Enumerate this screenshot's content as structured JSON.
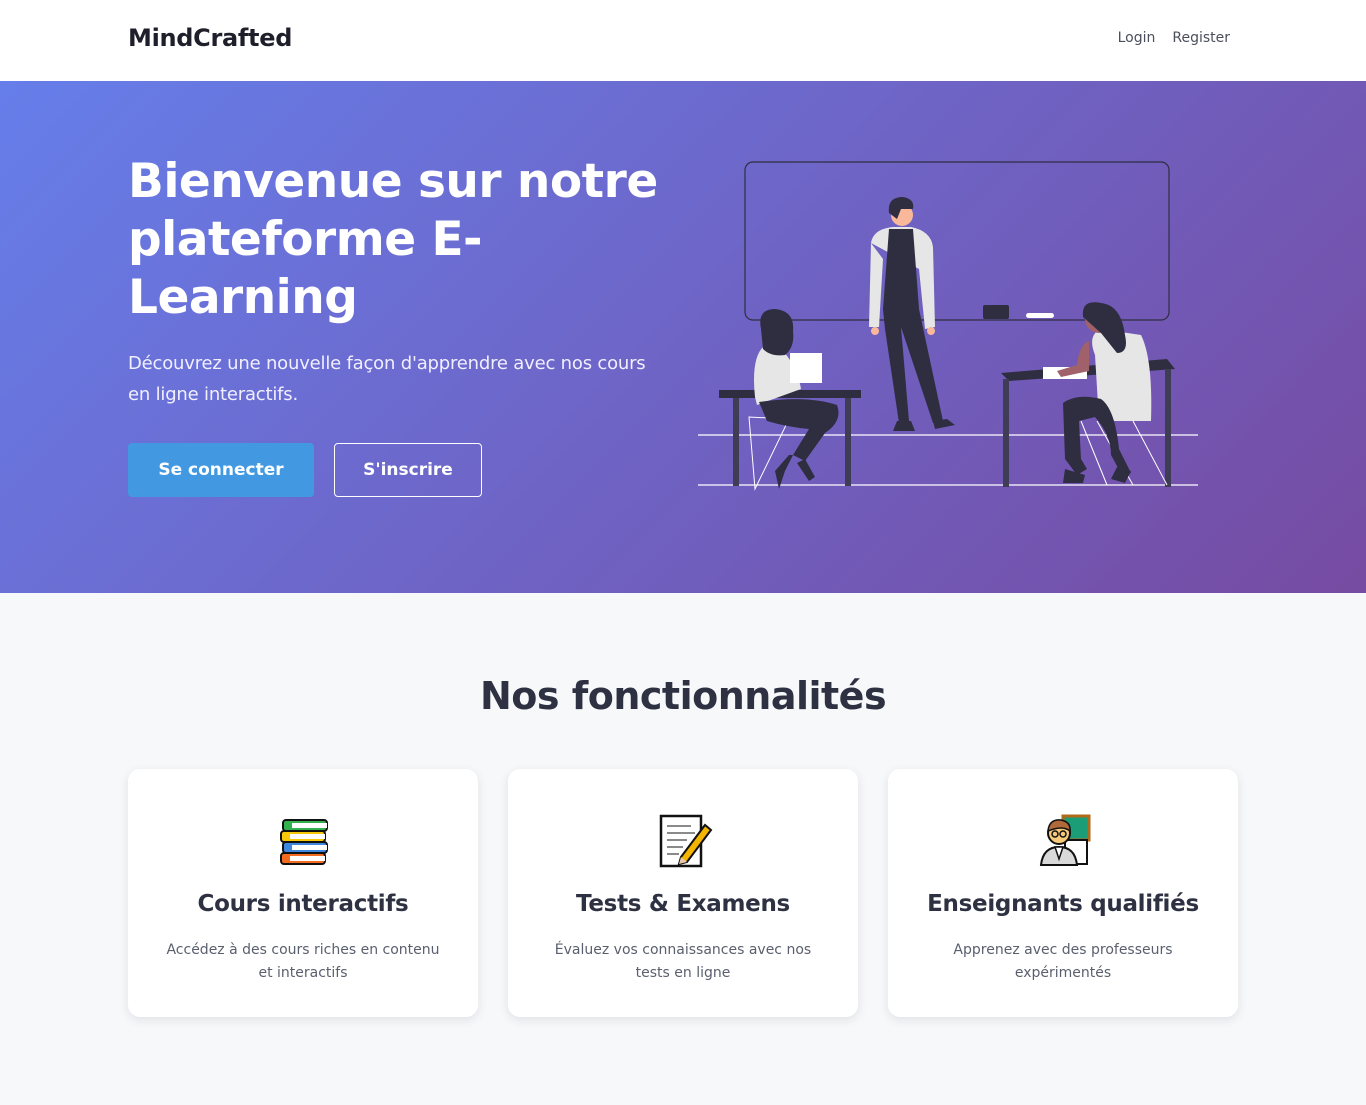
{
  "navbar": {
    "brand": "MindCrafted",
    "links": [
      "Login",
      "Register"
    ]
  },
  "hero": {
    "title": "Bienvenue sur notre plateforme E-Learning",
    "subtitle": "Découvrez une nouvelle façon d'apprendre avec nos cours en ligne interactifs.",
    "primary_button": "Se connecter",
    "secondary_button": "S'inscrire"
  },
  "features": {
    "title": "Nos fonctionnalités",
    "cards": [
      {
        "icon": "books-icon",
        "title": "Cours interactifs",
        "text": "Accédez à des cours riches en contenu et interactifs"
      },
      {
        "icon": "memo-icon",
        "title": "Tests & Examens",
        "text": "Évaluez vos connaissances avec nos tests en ligne"
      },
      {
        "icon": "teacher-icon",
        "title": "Enseignants qualifiés",
        "text": "Apprenez avec des professeurs expérimentés"
      }
    ]
  },
  "colors": {
    "hero_gradient_start": "#667eea",
    "hero_gradient_end": "#764ba2",
    "primary_button": "#4299e1",
    "page_background": "#f7f8fa"
  }
}
